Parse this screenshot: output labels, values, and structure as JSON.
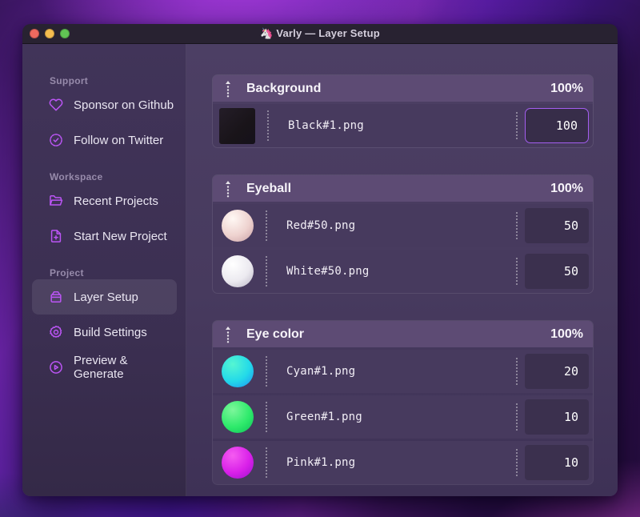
{
  "window": {
    "title": "Varly — Layer Setup",
    "title_emoji": "🦄"
  },
  "colors": {
    "accent_purple": "#bb55f5",
    "focus_border": "#a45ef0",
    "header_bar": "#5d4b74",
    "row_bg": "#473a5e",
    "traffic_red": "#ee6a5f",
    "traffic_yellow": "#f5bd4f",
    "traffic_green": "#61c554"
  },
  "sidebar": {
    "sections": [
      {
        "label": "Support",
        "items": [
          {
            "label": "Sponsor on Github",
            "icon": "heart-icon"
          },
          {
            "label": "Follow on Twitter",
            "icon": "badge-check-icon"
          }
        ]
      },
      {
        "label": "Workspace",
        "items": [
          {
            "label": "Recent Projects",
            "icon": "folder-icon"
          },
          {
            "label": "Start New Project",
            "icon": "file-plus-icon"
          }
        ]
      },
      {
        "label": "Project",
        "items": [
          {
            "label": "Layer Setup",
            "icon": "archive-icon",
            "active": true
          },
          {
            "label": "Build Settings",
            "icon": "gear-icon"
          },
          {
            "label": "Preview & Generate",
            "icon": "play-circle-icon"
          }
        ]
      }
    ]
  },
  "groups": [
    {
      "name": "Background",
      "weight": "100%",
      "rows": [
        {
          "filename": "Black#1.png",
          "value": "100",
          "focused": true,
          "thumb": {
            "shape": "square",
            "colors": [
              "#241d28",
              "#191419",
              "#15111a"
            ]
          }
        }
      ]
    },
    {
      "name": "Eyeball",
      "weight": "100%",
      "rows": [
        {
          "filename": "Red#50.png",
          "value": "50",
          "thumb": {
            "shape": "ball",
            "colors": [
              "#fff8f4",
              "#eed2cf",
              "#c9a0a4"
            ]
          }
        },
        {
          "filename": "White#50.png",
          "value": "50",
          "thumb": {
            "shape": "ball",
            "colors": [
              "#ffffff",
              "#eceaf0",
              "#b7b2c2"
            ]
          }
        }
      ]
    },
    {
      "name": "Eye color",
      "weight": "100%",
      "rows": [
        {
          "filename": "Cyan#1.png",
          "value": "20",
          "thumb": {
            "shape": "ball",
            "colors": [
              "#55f6d2",
              "#23d9e9",
              "#1e8ef2"
            ]
          }
        },
        {
          "filename": "Green#1.png",
          "value": "10",
          "thumb": {
            "shape": "ball",
            "colors": [
              "#7df69b",
              "#2eea6b",
              "#0cc058"
            ]
          }
        },
        {
          "filename": "Pink#1.png",
          "value": "10",
          "thumb": {
            "shape": "ball",
            "colors": [
              "#f55cf1",
              "#d920e9",
              "#9a11cc"
            ]
          }
        }
      ]
    }
  ]
}
